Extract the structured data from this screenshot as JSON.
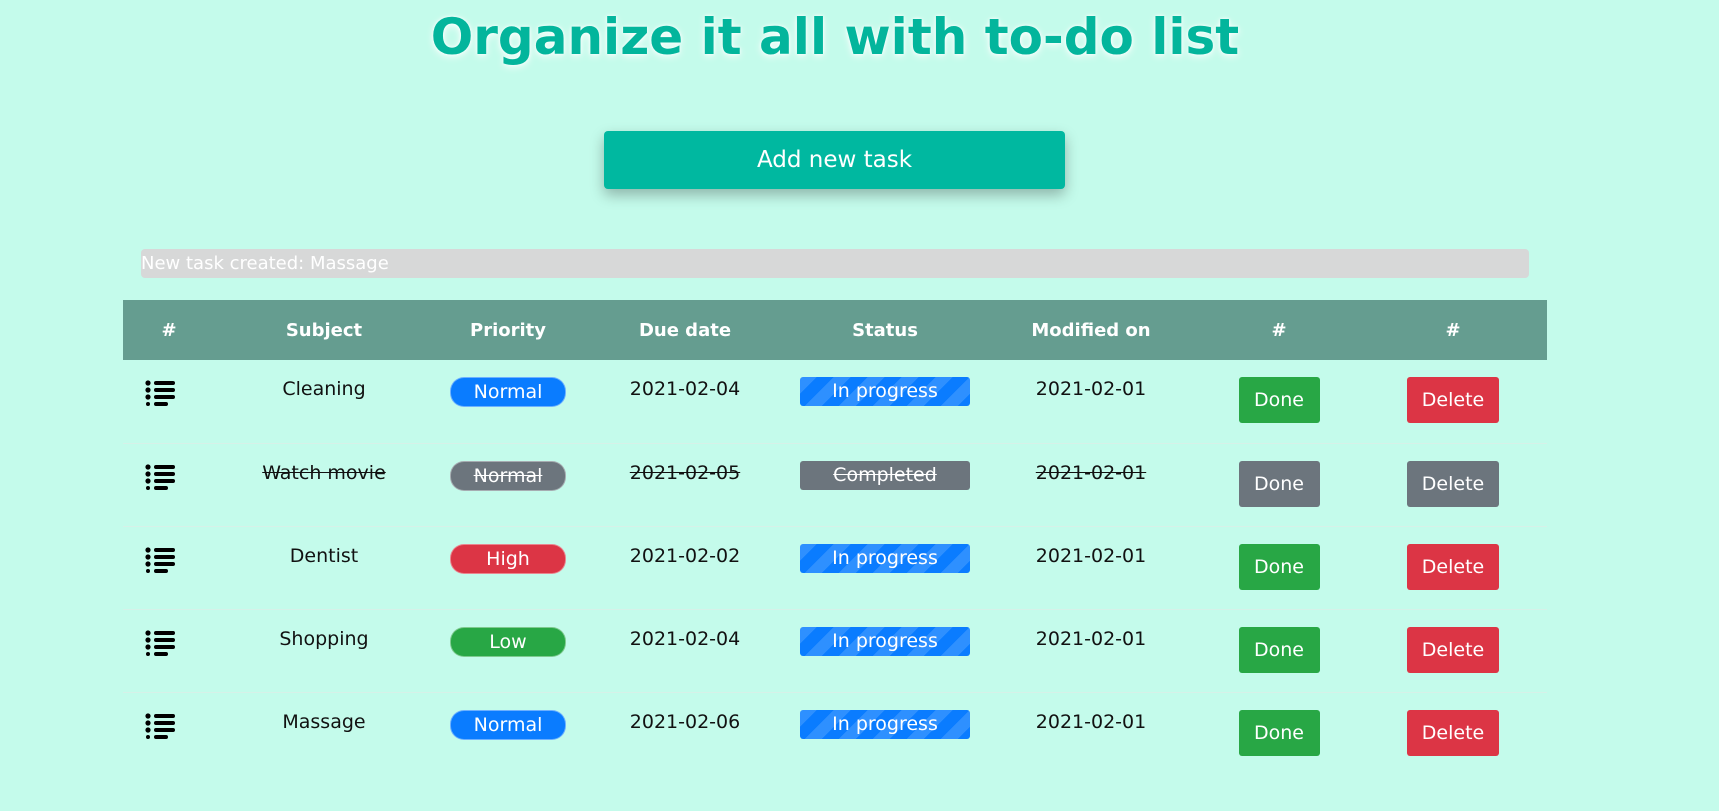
{
  "page": {
    "title": "Organize it all with to-do list",
    "add_button_label": "Add new task",
    "notice": "New task created: Massage"
  },
  "colors": {
    "background": "#c4fbeb",
    "accent": "#03b59c",
    "header": "#659d90",
    "normal": "#0a7cff",
    "high": "#dc3545",
    "low": "#28a745",
    "muted": "#6c757d"
  },
  "table": {
    "headers": [
      "#",
      "Subject",
      "Priority",
      "Due date",
      "Status",
      "Modified on",
      "#",
      "#"
    ],
    "rows": [
      {
        "icon": "list-icon",
        "subject": "Cleaning",
        "priority": "Normal",
        "priority_color": "#0a7cff",
        "due": "2021-02-04",
        "status": "In progress",
        "modified": "2021-02-01",
        "done_label": "Done",
        "delete_label": "Delete",
        "completed": false
      },
      {
        "icon": "list-icon",
        "subject": "Watch movie",
        "priority": "Normal",
        "priority_color": "#6c757d",
        "due": "2021-02-05",
        "status": "Completed",
        "modified": "2021-02-01",
        "done_label": "Done",
        "delete_label": "Delete",
        "completed": true
      },
      {
        "icon": "list-icon",
        "subject": "Dentist",
        "priority": "High",
        "priority_color": "#dc3545",
        "due": "2021-02-02",
        "status": "In progress",
        "modified": "2021-02-01",
        "done_label": "Done",
        "delete_label": "Delete",
        "completed": false
      },
      {
        "icon": "list-icon",
        "subject": "Shopping",
        "priority": "Low",
        "priority_color": "#28a745",
        "due": "2021-02-04",
        "status": "In progress",
        "modified": "2021-02-01",
        "done_label": "Done",
        "delete_label": "Delete",
        "completed": false
      },
      {
        "icon": "list-icon",
        "subject": "Massage",
        "priority": "Normal",
        "priority_color": "#0a7cff",
        "due": "2021-02-06",
        "status": "In progress",
        "modified": "2021-02-01",
        "done_label": "Done",
        "delete_label": "Delete",
        "completed": false
      }
    ]
  }
}
